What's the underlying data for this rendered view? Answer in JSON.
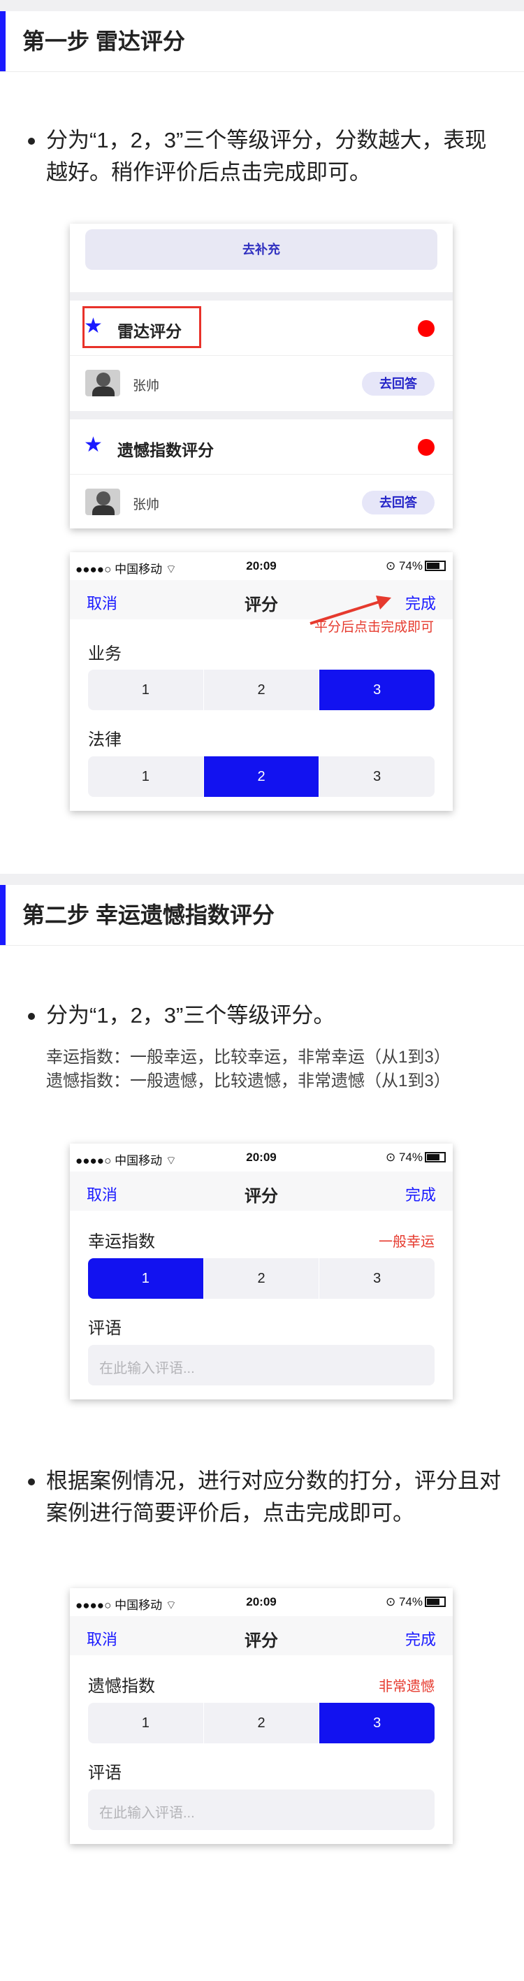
{
  "step1": {
    "title": "第一步 雷达评分",
    "bullet": "分为“1，2，3”三个等级评分，分数越大，表现越好。稍作评价后点击完成即可。",
    "list_shot": {
      "fill_button": "去补充",
      "items": [
        {
          "title": "雷达评分",
          "user": "张帅",
          "answer": "去回答"
        },
        {
          "title": "遗憾指数评分",
          "user": "张帅",
          "answer": "去回答"
        }
      ]
    },
    "rating_shot": {
      "status": {
        "carrier": "●●●●○ 中国移动",
        "wifi": "⌔",
        "time": "20:09",
        "battery": "74%",
        "lock": "⊙"
      },
      "nav": {
        "cancel": "取消",
        "title": "评分",
        "done": "完成"
      },
      "annotation": "平分后点击完成即可",
      "groups": [
        {
          "label": "业务",
          "options": [
            "1",
            "2",
            "3"
          ],
          "selected": 3
        },
        {
          "label": "法律",
          "options": [
            "1",
            "2",
            "3"
          ],
          "selected": 2
        }
      ]
    }
  },
  "step2": {
    "title": "第二步 幸运遗憾指数评分",
    "bullet": "分为“1，2，3”三个等级评分。",
    "note1": "幸运指数：一般幸运，比较幸运，非常幸运（从1到3）",
    "note2": "遗憾指数：一般遗憾，比较遗憾，非常遗憾（从1到3）",
    "lucky_shot": {
      "status": {
        "carrier": "●●●●○ 中国移动",
        "wifi": "⌔",
        "time": "20:09",
        "battery": "74%",
        "lock": "⊙"
      },
      "nav": {
        "cancel": "取消",
        "title": "评分",
        "done": "完成"
      },
      "label": "幸运指数",
      "level": "一般幸运",
      "options": [
        "1",
        "2",
        "3"
      ],
      "selected": 1,
      "comment_label": "评语",
      "comment_placeholder": "在此输入评语..."
    },
    "bullet2": "根据案例情况，进行对应分数的打分，评分且对案例进行简要评价后，点击完成即可。",
    "regret_shot": {
      "status": {
        "carrier": "●●●●○ 中国移动",
        "wifi": "⌔",
        "time": "20:09",
        "battery": "74%",
        "lock": "⊙"
      },
      "nav": {
        "cancel": "取消",
        "title": "评分",
        "done": "完成"
      },
      "label": "遗憾指数",
      "level": "非常遗憾",
      "options": [
        "1",
        "2",
        "3"
      ],
      "selected": 3,
      "comment_label": "评语",
      "comment_placeholder": "在此输入评语..."
    }
  },
  "colors": {
    "accent": "#1a1aff",
    "selected": "#1212f0",
    "annotation": "#e63a2e",
    "dot": "#ff0000"
  }
}
